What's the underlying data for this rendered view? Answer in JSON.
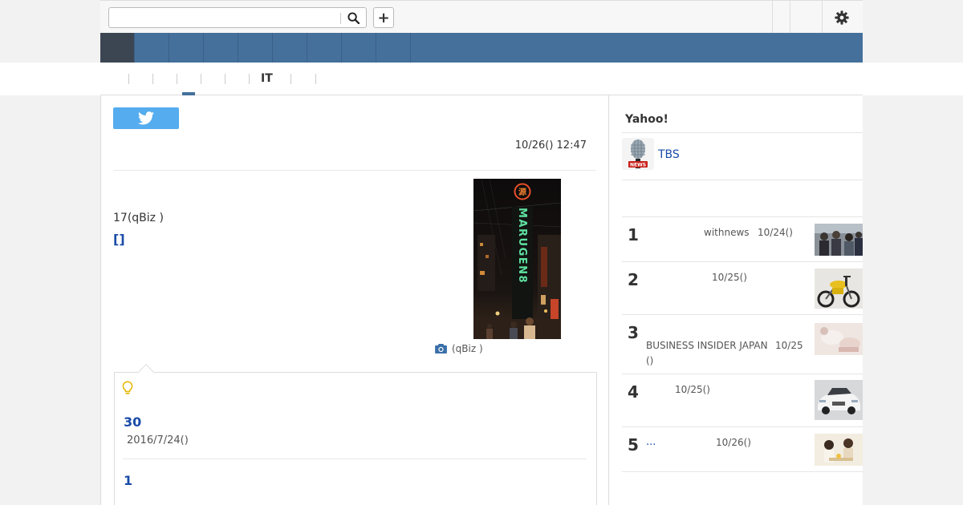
{
  "search": {
    "placeholder": "",
    "value": ""
  },
  "topbar": {
    "plus_label": "+"
  },
  "subnav": {
    "it_label": "IT"
  },
  "article": {
    "date": "10/26() 12:47",
    "body": "17(qBiz )",
    "bracket_link": "[]",
    "photo_caption": "(qBiz )",
    "sign_text": "MARUGEN8"
  },
  "related": {
    "title1": "30",
    "date1": "2016/7/24()",
    "title2": "1"
  },
  "sidebar": {
    "title": "Yahoo!",
    "source_name": "TBS",
    "ranking": [
      {
        "num": "1",
        "source": "withnews",
        "date": "10/24()"
      },
      {
        "num": "2",
        "source": "",
        "date": "10/25()"
      },
      {
        "num": "3",
        "source": "BUSINESS INSIDER JAPAN",
        "date": "10/25",
        "date_cont": "()"
      },
      {
        "num": "4",
        "source": "",
        "date": "10/25()"
      },
      {
        "num": "5",
        "more": "...",
        "source": "",
        "date": "10/26()"
      }
    ]
  },
  "colors": {
    "nav_blue": "#45709b",
    "nav_active": "#3c4653",
    "link_blue": "#1a4ca8",
    "twitter": "#55acee"
  }
}
